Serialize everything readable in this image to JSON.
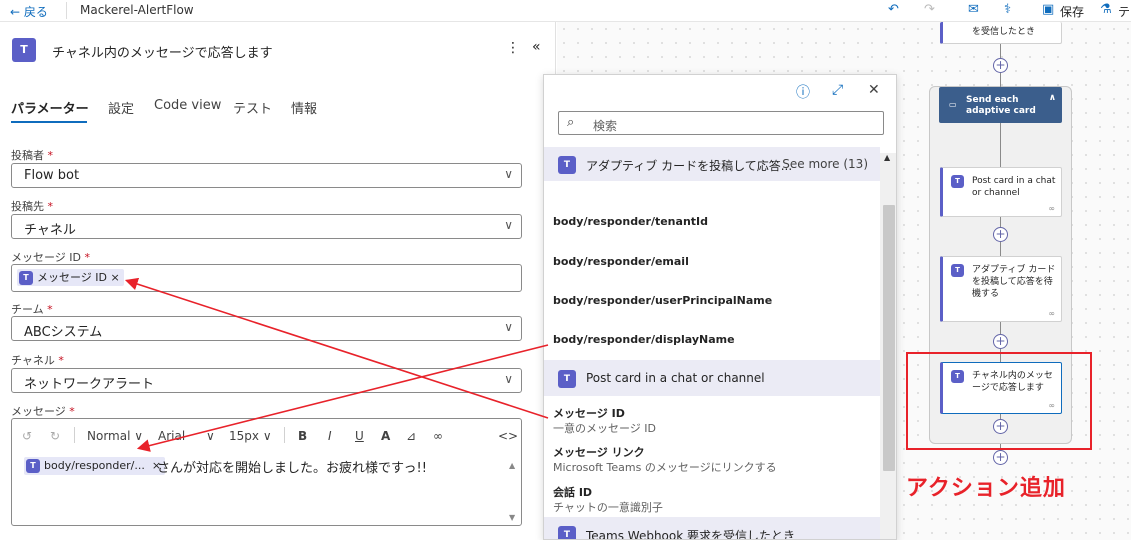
{
  "topbar": {
    "back_label": "← 戻る",
    "flow_name": "Mackerel-AlertFlow",
    "save_label": "保存",
    "test_label": "テ"
  },
  "panel": {
    "title": "チャネル内のメッセージで応答します",
    "tabs": [
      "パラメーター",
      "設定",
      "Code view",
      "テスト",
      "情報"
    ],
    "fields": [
      {
        "label": "投稿者",
        "value": "Flow bot"
      },
      {
        "label": "投稿先",
        "value": "チャネル"
      },
      {
        "label": "メッセージ ID",
        "token": "メッセージ ID ×"
      },
      {
        "label": "チーム",
        "value": "ABCシステム"
      },
      {
        "label": "チャネル",
        "value": "ネットワークアラート"
      }
    ],
    "message": {
      "label": "メッセージ",
      "format": "Normal",
      "font": "Arial",
      "size": "15px",
      "token": "body/responder/...",
      "token_close": "×",
      "text": "さんが対応を開始しました。お疲れ様ですっ!!"
    }
  },
  "dynamic": {
    "search_placeholder": "検索",
    "group1_title": "アダプティブ カードを投稿して応答...",
    "group1_more": "See more (13)",
    "items": [
      "body/responder/tenantId",
      "body/responder/email",
      "body/responder/userPrincipalName",
      "body/responder/displayName"
    ],
    "group2_title": "Post card in a chat or channel",
    "items2": [
      {
        "name": "メッセージ ID",
        "desc": "一意のメッセージ ID"
      },
      {
        "name": "メッセージ リンク",
        "desc": "Microsoft Teams のメッセージにリンクする"
      },
      {
        "name": "会話 ID",
        "desc": "チャットの一意識別子"
      }
    ],
    "group3_title": "Teams Webhook 要求を受信したとき"
  },
  "canvas": {
    "top_card": "を受信したとき",
    "send_each": "Send each adaptive card",
    "card1": "Post card in a chat or channel",
    "card2": "アダプティブ カードを投稿して応答を待機する",
    "card3": "チャネル内のメッセージで応答します",
    "annotation": "アクション追加"
  }
}
